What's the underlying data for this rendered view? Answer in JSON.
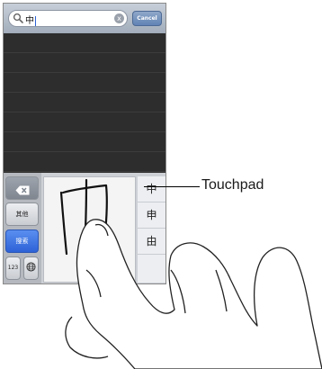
{
  "search": {
    "query": "中",
    "clear_icon": "x",
    "cancel_label": "Cancel"
  },
  "keyboard": {
    "delete_icon": "backspace-icon",
    "other_label": "其他",
    "search_label": "搜索",
    "numbers_label": "123",
    "globe_icon": "globe-icon",
    "candidates": [
      "中",
      "申",
      "由"
    ]
  },
  "callout": {
    "label": "Touchpad"
  }
}
